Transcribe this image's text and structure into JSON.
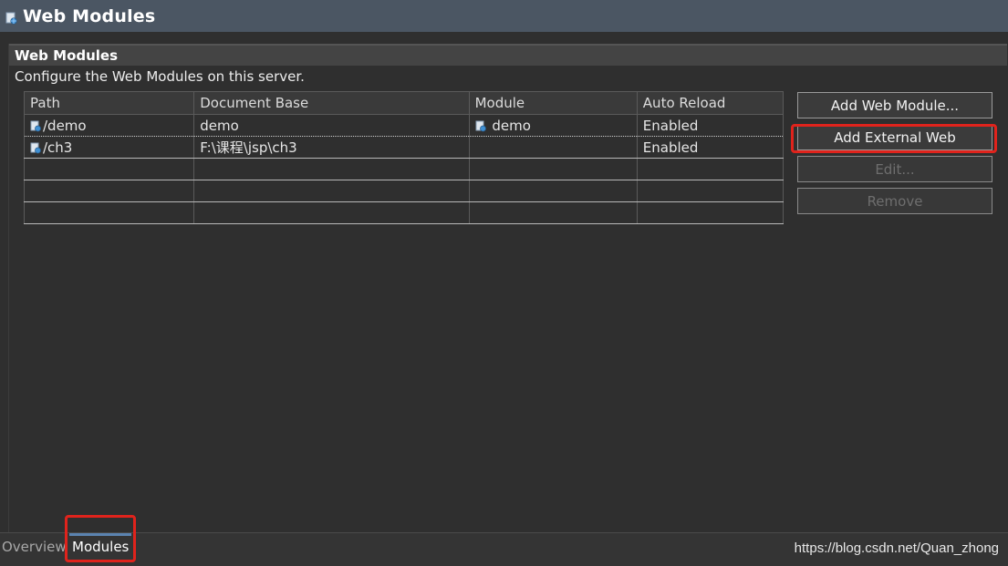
{
  "window": {
    "title": "Web Modules"
  },
  "section": {
    "title": "Web Modules",
    "description": "Configure the Web Modules on this server."
  },
  "table": {
    "columns": [
      "Path",
      "Document Base",
      "Module",
      "Auto Reload"
    ],
    "rows": [
      {
        "path": "/demo",
        "document_base": "demo",
        "module": "demo",
        "auto_reload": "Enabled"
      },
      {
        "path": "/ch3",
        "document_base": "F:\\课程\\jsp\\ch3",
        "module": "",
        "auto_reload": "Enabled"
      }
    ]
  },
  "buttons": {
    "add_web_module": "Add Web Module...",
    "add_external": "Add External Web Module...",
    "edit": "Edit...",
    "remove": "Remove"
  },
  "tabs": {
    "overview": "Overview",
    "modules": "Modules"
  },
  "watermark": "https://blog.csdn.net/Quan_zhong",
  "colors": {
    "highlight": "#e0231c",
    "title_bar": "#4b5663",
    "background": "#2f2f2f"
  },
  "icons": {
    "module": "web-module-icon"
  }
}
